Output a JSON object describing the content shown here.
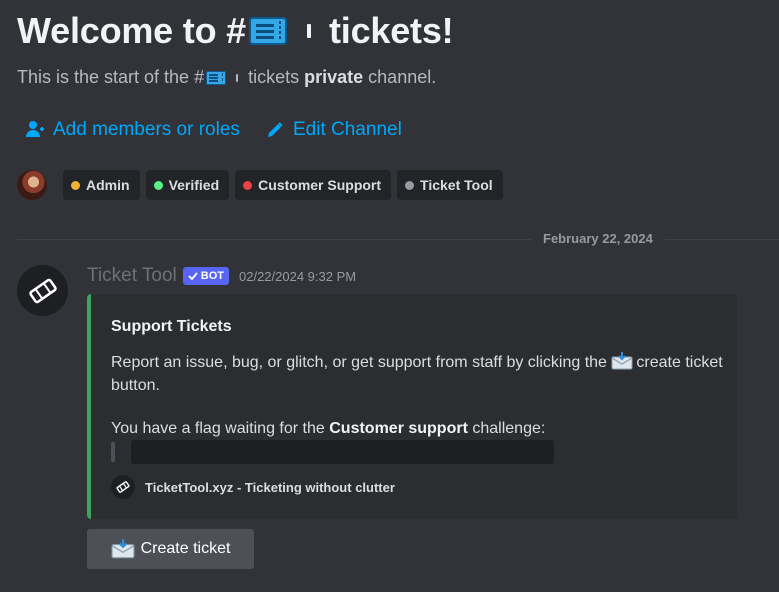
{
  "header": {
    "title_prefix": "Welcome to #",
    "title_suffix": "tickets!",
    "subtitle_prefix": "This is the start of the #",
    "subtitle_channel": "tickets",
    "subtitle_bold": "private",
    "subtitle_suffix": "channel."
  },
  "actions": {
    "add_members": "Add members or roles",
    "edit_channel": "Edit Channel"
  },
  "roles": [
    {
      "name": "Admin",
      "color": "#f0b232"
    },
    {
      "name": "Verified",
      "color": "#57f287"
    },
    {
      "name": "Customer Support",
      "color": "#ed4245"
    },
    {
      "name": "Ticket Tool",
      "color": "#949ba4"
    }
  ],
  "divider": {
    "date": "February 22, 2024"
  },
  "message": {
    "author": "Ticket Tool",
    "bot_tag": "BOT",
    "timestamp": "02/22/2024 9:32 PM",
    "embed": {
      "accent": "#3ba55d",
      "title": "Support Tickets",
      "desc_prefix": "Report an issue, bug, or glitch, or get support from staff by clicking the",
      "desc_suffix": "create ticket button.",
      "flag_prefix": "You have a flag waiting for the",
      "flag_bold": "Customer support",
      "flag_suffix": "challenge:",
      "footer": "TicketTool.xyz - Ticketing without clutter"
    },
    "button_label": "Create ticket"
  }
}
